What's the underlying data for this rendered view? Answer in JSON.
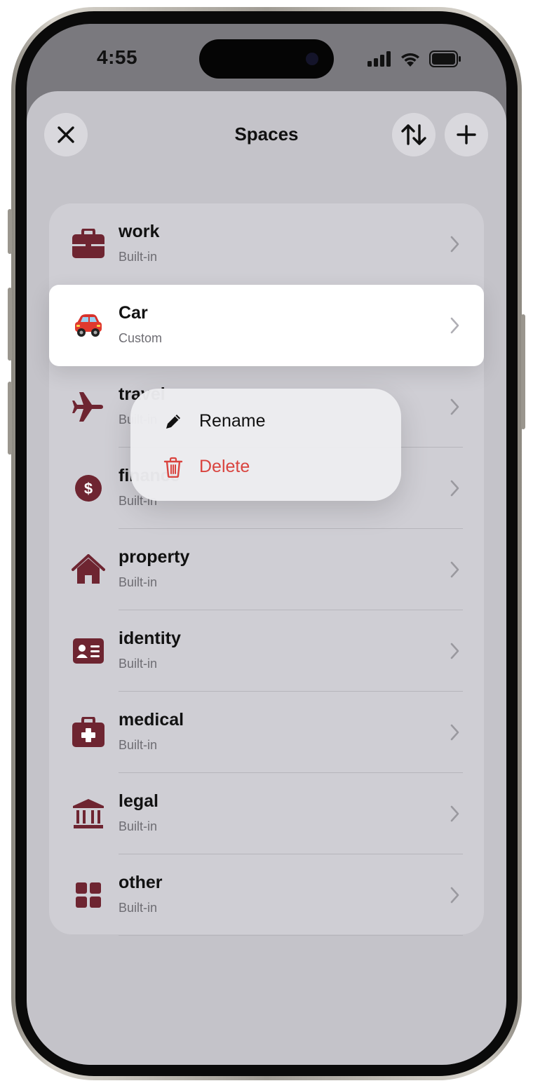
{
  "status_bar": {
    "time": "4:55"
  },
  "header": {
    "title": "Spaces"
  },
  "colors": {
    "accent": "#6e2531",
    "destructive": "#d9443f"
  },
  "spaces": [
    {
      "name": "work",
      "subtitle": "Built-in",
      "icon": "briefcase-icon"
    },
    {
      "name": "Car",
      "subtitle": "Custom",
      "icon": "car-emoji-icon"
    },
    {
      "name": "travel",
      "subtitle": "Built-in",
      "icon": "airplane-icon"
    },
    {
      "name": "finance",
      "subtitle": "Built-in",
      "icon": "dollar-circle-icon"
    },
    {
      "name": "property",
      "subtitle": "Built-in",
      "icon": "house-icon"
    },
    {
      "name": "identity",
      "subtitle": "Built-in",
      "icon": "id-card-icon"
    },
    {
      "name": "medical",
      "subtitle": "Built-in",
      "icon": "medical-kit-icon"
    },
    {
      "name": "legal",
      "subtitle": "Built-in",
      "icon": "bank-building-icon"
    },
    {
      "name": "other",
      "subtitle": "Built-in",
      "icon": "grid-squares-icon"
    }
  ],
  "context_menu": {
    "rename": {
      "label": "Rename",
      "icon": "pencil-icon"
    },
    "delete": {
      "label": "Delete",
      "icon": "trash-icon"
    }
  }
}
